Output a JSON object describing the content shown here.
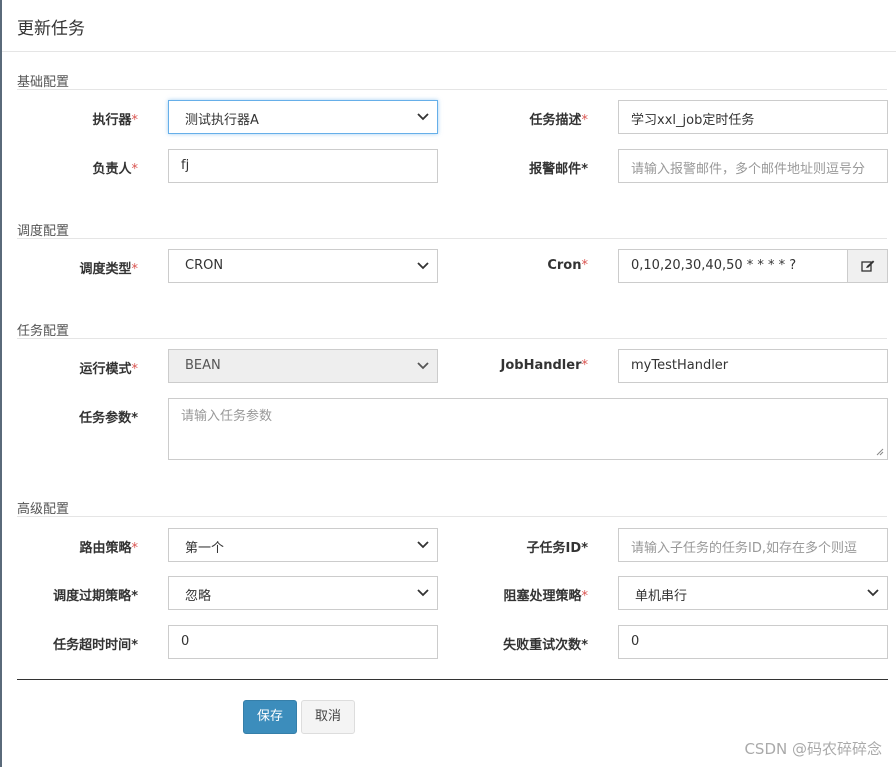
{
  "title": "更新任务",
  "sections": {
    "basic": "基础配置",
    "schedule": "调度配置",
    "task": "任务配置",
    "advanced": "高级配置"
  },
  "fields": {
    "executor": {
      "label": "执行器",
      "value": "测试执行器A"
    },
    "job_desc": {
      "label": "任务描述",
      "value": "学习xxl_job定时任务"
    },
    "author": {
      "label": "负责人",
      "value": "fj"
    },
    "alarm_email": {
      "label": "报警邮件",
      "placeholder": "请输入报警邮件，多个邮件地址则逗号分"
    },
    "schedule_type": {
      "label": "调度类型",
      "value": "CRON"
    },
    "cron": {
      "label": "Cron",
      "value": "0,10,20,30,40,50 * * * * ?"
    },
    "run_mode": {
      "label": "运行模式",
      "value": "BEAN"
    },
    "job_handler": {
      "label": "JobHandler",
      "value": "myTestHandler"
    },
    "job_param": {
      "label": "任务参数",
      "placeholder": "请输入任务参数"
    },
    "route_strategy": {
      "label": "路由策略",
      "value": "第一个"
    },
    "child_job_id": {
      "label": "子任务ID",
      "placeholder": "请输入子任务的任务ID,如存在多个则逗"
    },
    "misfire_strategy": {
      "label": "调度过期策略",
      "value": "忽略"
    },
    "block_strategy": {
      "label": "阻塞处理策略",
      "value": "单机串行"
    },
    "timeout": {
      "label": "任务超时时间",
      "value": "0"
    },
    "fail_retry": {
      "label": "失败重试次数",
      "value": "0"
    }
  },
  "required_mark": "*",
  "buttons": {
    "save": "保存",
    "cancel": "取消"
  },
  "watermark": "CSDN @码农碎碎念",
  "icons": {
    "cron_edit": "edit-icon",
    "dropdown": "chevron-down-icon"
  },
  "colors": {
    "primary": "#3c8dbc",
    "required": "#d9534f",
    "focus": "#66afe9"
  }
}
